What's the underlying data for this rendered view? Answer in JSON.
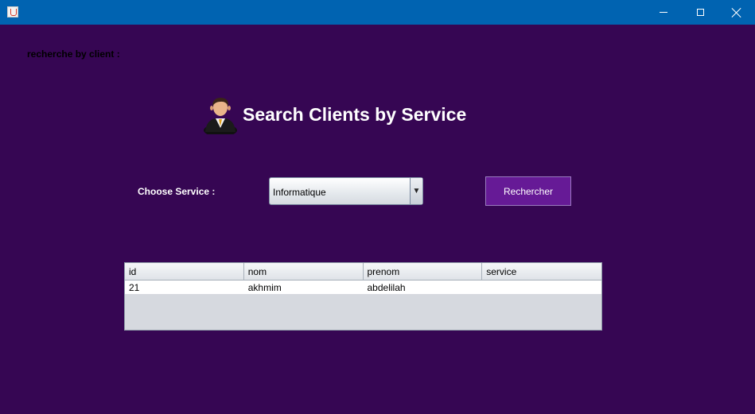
{
  "window": {
    "title": "",
    "icon": "java-icon",
    "controls": [
      "minimize",
      "maximize",
      "close"
    ]
  },
  "top_label": "recherche by client :",
  "heading": "Search Clients by Service",
  "avatar_icon": "client-avatar-icon",
  "form": {
    "choose_label": "Choose Service :",
    "service_selected": "Informatique",
    "search_button": "Rechercher"
  },
  "table": {
    "columns": [
      "id",
      "nom",
      "prenom",
      "service"
    ],
    "rows": [
      [
        "21",
        "akhmim",
        "abdelilah",
        ""
      ]
    ]
  },
  "colors": {
    "background": "#360653",
    "titlebar": "#0063b1",
    "button": "#661a96"
  }
}
